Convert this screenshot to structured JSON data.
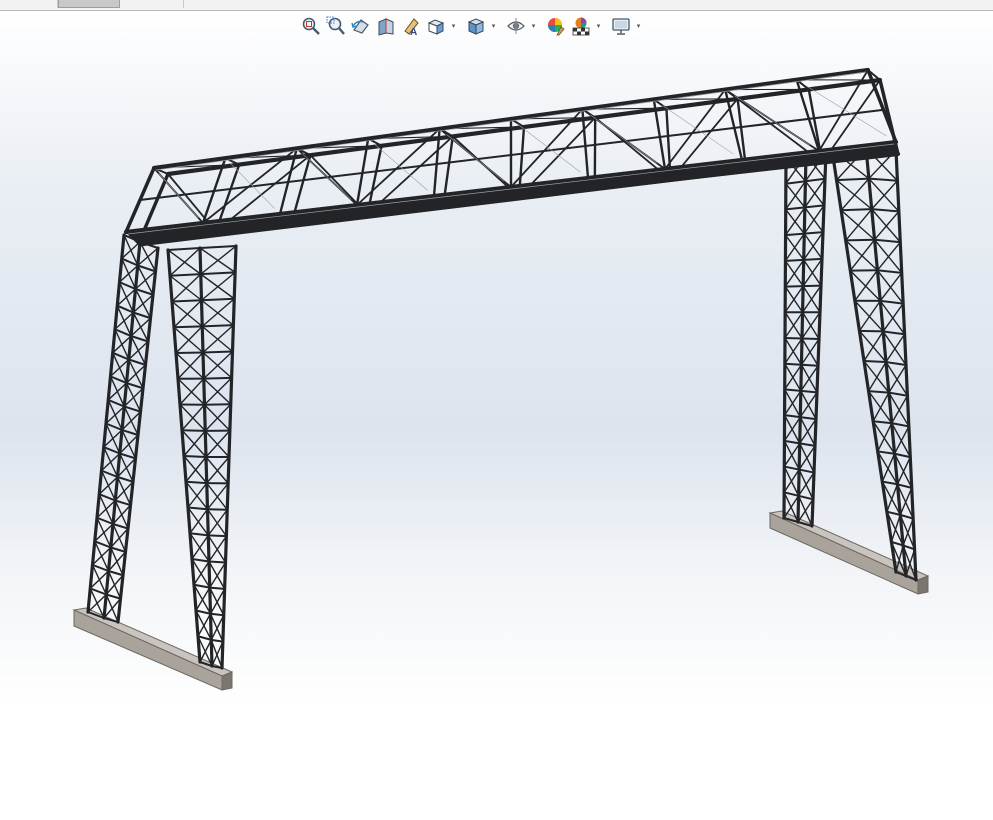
{
  "tabs": [
    {
      "label": "",
      "active": false
    },
    {
      "label": "",
      "active": true
    },
    {
      "label": "",
      "active": false
    }
  ],
  "toolbar": {
    "icons": [
      "zoom-to-fit-icon",
      "zoom-to-area-icon",
      "previous-view-icon",
      "section-view-icon",
      "dynamic-annotation-views-icon",
      "view-orientation-icon",
      "display-style-icon",
      "hide-show-items-icon",
      "edit-appearance-icon",
      "apply-scene-icon",
      "view-settings-icon"
    ],
    "dropdown_glyph": "▾"
  },
  "colors": {
    "steel": "#232427",
    "steel_highlight": "#9aa0a8",
    "base_plate": "#a9a39c",
    "base_plate_dark": "#6e6862",
    "viewport_top": "#ffffff",
    "viewport_mid": "#dde4ee"
  }
}
